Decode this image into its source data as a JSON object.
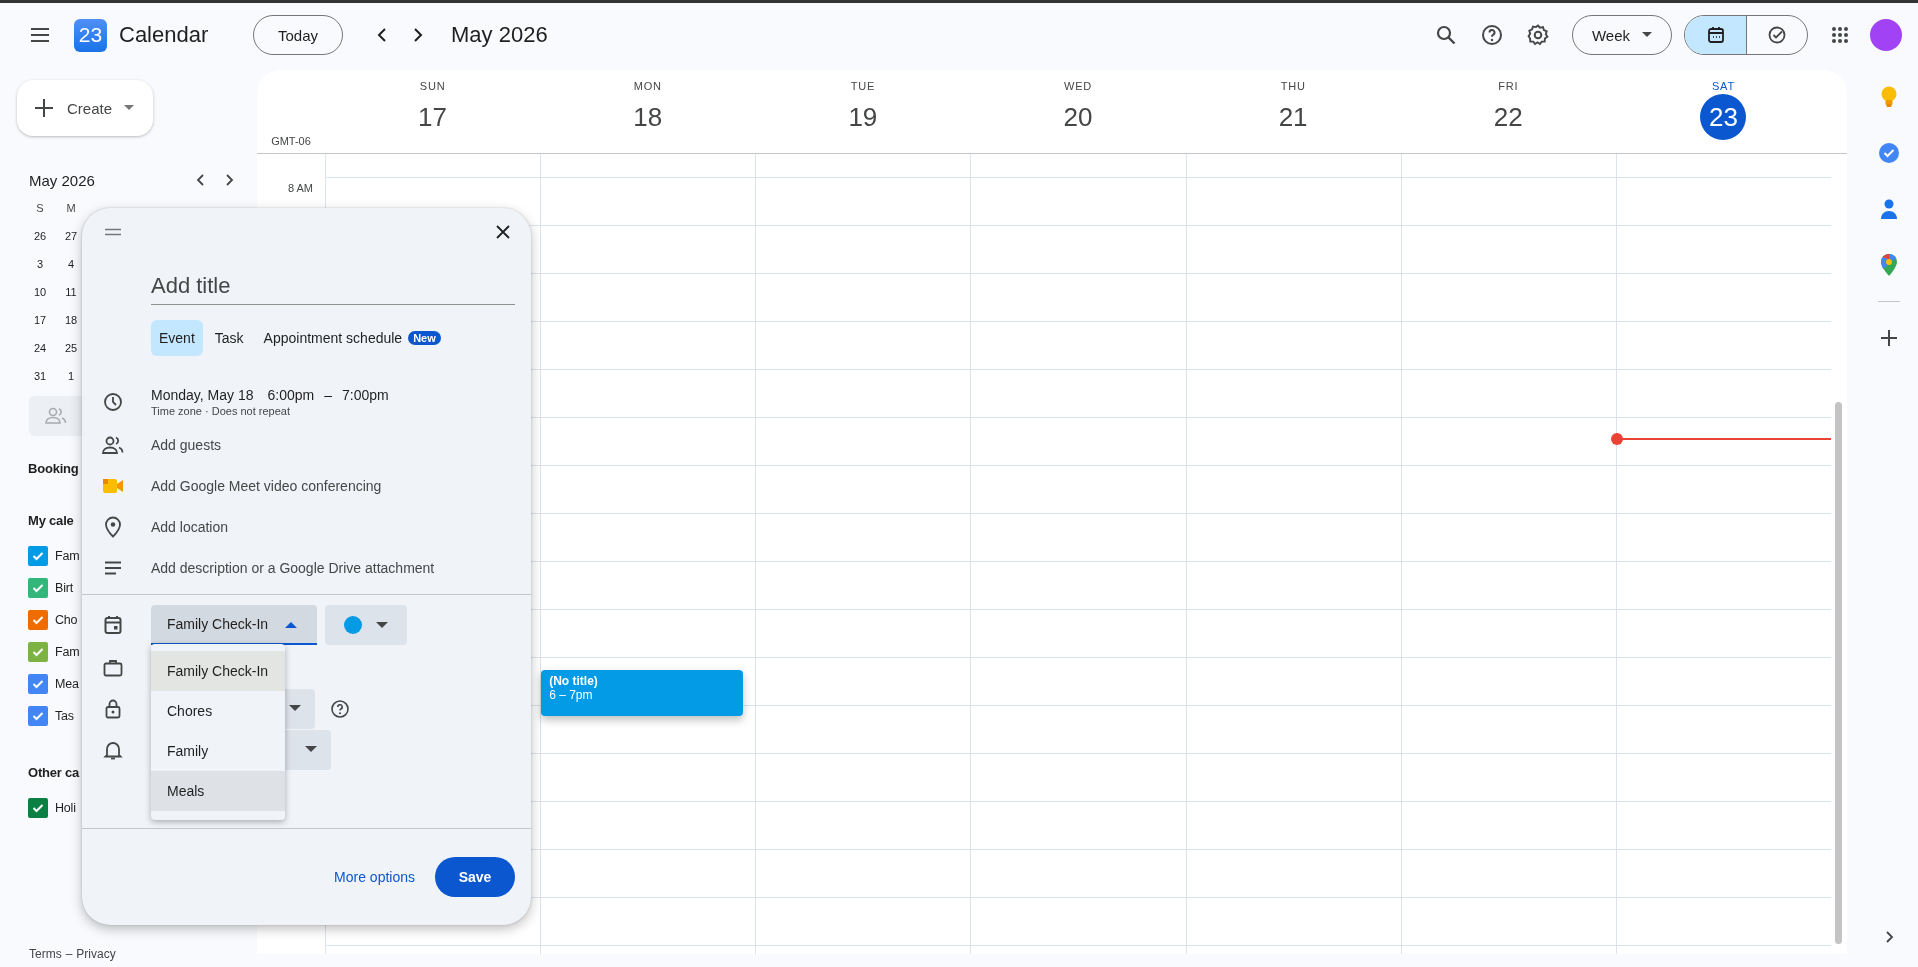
{
  "app": {
    "logo_day": "23",
    "name": "Calendar"
  },
  "toolbar": {
    "today": "Today",
    "period": "May 2026",
    "view": "Week",
    "view_toggle": [
      {
        "kind": "calendar",
        "selected": true
      },
      {
        "kind": "tasks",
        "selected": false
      }
    ]
  },
  "create": "Create",
  "mini_calendar": {
    "title": "May 2026",
    "weekdays": [
      "S",
      "M"
    ],
    "weeks": [
      [
        "26",
        "27"
      ],
      [
        "3",
        "4"
      ],
      [
        "10",
        "11"
      ],
      [
        "17",
        "18"
      ],
      [
        "24",
        "25"
      ],
      [
        "31",
        "1"
      ]
    ]
  },
  "sections": [
    {
      "title": "Booking"
    },
    {
      "title": "My cale",
      "calendars": [
        {
          "label": "Fam",
          "checked": true,
          "color": "#039be5"
        },
        {
          "label": "Birt",
          "checked": true,
          "color": "#33b679"
        },
        {
          "label": "Cho",
          "checked": true,
          "color": "#ef6c00"
        },
        {
          "label": "Fam",
          "checked": true,
          "color": "#7cb342"
        },
        {
          "label": "Mea",
          "checked": true,
          "color": "#4285f4"
        },
        {
          "label": "Tas",
          "checked": true,
          "color": "#4285f4"
        }
      ]
    },
    {
      "title": "Other ca",
      "calendars": [
        {
          "label": "Holi",
          "checked": true,
          "color": "#0b8043"
        }
      ]
    }
  ],
  "footer": [
    "Terms",
    "–",
    "Privacy"
  ],
  "week": {
    "timezone": "GMT-06",
    "hours": [
      "8 AM"
    ],
    "days": [
      {
        "name": "SUN",
        "date": "17",
        "today": false
      },
      {
        "name": "MON",
        "date": "18",
        "today": false,
        "events": [
          {
            "title": "(No title)",
            "time": "6 – 7pm",
            "color": "#039be5"
          }
        ]
      },
      {
        "name": "TUE",
        "date": "19",
        "today": false
      },
      {
        "name": "WED",
        "date": "20",
        "today": false
      },
      {
        "name": "THU",
        "date": "21",
        "today": false
      },
      {
        "name": "FRI",
        "date": "22",
        "today": false
      },
      {
        "name": "SAT",
        "date": "23",
        "today": true
      }
    ]
  },
  "dialog": {
    "title_placeholder": "Add title",
    "tabs": [
      {
        "label": "Event",
        "selected": true
      },
      {
        "label": "Task",
        "selected": false
      },
      {
        "label": "Appointment schedule",
        "selected": false,
        "badge": "New"
      }
    ],
    "date": "Monday, May 18",
    "start": "6:00pm",
    "dash": "–",
    "end": "7:00pm",
    "details": "Time zone · Does not repeat",
    "rows": [
      {
        "kind": "guests",
        "label": "Add guests"
      },
      {
        "kind": "meet",
        "label": "Add Google Meet video conferencing"
      },
      {
        "kind": "location",
        "label": "Add location"
      },
      {
        "kind": "description",
        "label": "Add description or a Google Drive attachment"
      }
    ],
    "calendar_select": {
      "value": "Family Check-In",
      "expanded": true,
      "color": "#039be5"
    },
    "menu": [
      {
        "label": "Family Check-In",
        "selected": true,
        "hovered": false
      },
      {
        "label": "Chores",
        "selected": false,
        "hovered": false
      },
      {
        "label": "Family",
        "selected": false,
        "hovered": false
      },
      {
        "label": "Meals",
        "selected": false,
        "hovered": true
      }
    ],
    "more_options": "More options",
    "save": "Save"
  }
}
